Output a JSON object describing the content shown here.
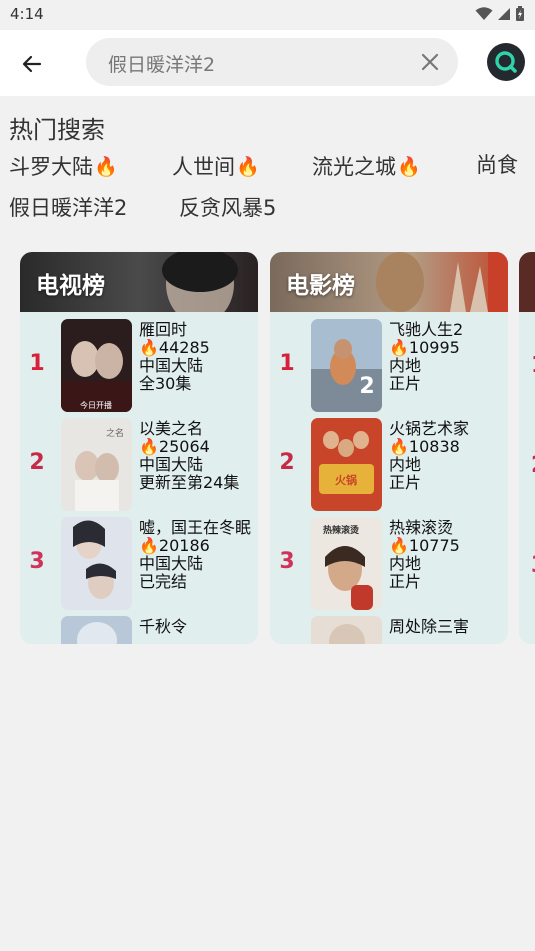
{
  "status": {
    "time": "4:14"
  },
  "search": {
    "query": "假日暖洋洋2"
  },
  "hot": {
    "title": "热门搜索",
    "items": [
      {
        "label": "斗罗大陆",
        "fire": true
      },
      {
        "label": "人世间",
        "fire": true
      },
      {
        "label": "流光之城",
        "fire": true
      },
      {
        "label": "尚食",
        "fire": false
      },
      {
        "label": "假日暖洋洋2",
        "fire": false
      },
      {
        "label": "反贪风暴5",
        "fire": false
      }
    ]
  },
  "rankings": [
    {
      "title": "电视榜",
      "items": [
        {
          "rank": "1",
          "name": "雁回时",
          "heat": "44285",
          "region": "中国大陆",
          "status": "全30集"
        },
        {
          "rank": "2",
          "name": "以美之名",
          "heat": "25064",
          "region": "中国大陆",
          "status": "更新至第24集"
        },
        {
          "rank": "3",
          "name": "嘘，国王在冬眠",
          "heat": "20186",
          "region": "中国大陆",
          "status": "已完结"
        },
        {
          "rank": "",
          "name": "千秋令",
          "heat": "",
          "region": "",
          "status": ""
        }
      ]
    },
    {
      "title": "电影榜",
      "items": [
        {
          "rank": "1",
          "name": "飞驰人生2",
          "heat": "10995",
          "region": "内地",
          "status": "正片"
        },
        {
          "rank": "2",
          "name": "火锅艺术家",
          "heat": "10838",
          "region": "内地",
          "status": "正片"
        },
        {
          "rank": "3",
          "name": "热辣滚烫",
          "heat": "10775",
          "region": "内地",
          "status": "正片"
        },
        {
          "rank": "",
          "name": "周处除三害",
          "heat": "",
          "region": "",
          "status": ""
        }
      ]
    }
  ],
  "colors": {
    "rank1": "#d8203a",
    "rank2": "#c62a47",
    "rank3": "#d0325a",
    "accent": "#2fd4a8"
  }
}
